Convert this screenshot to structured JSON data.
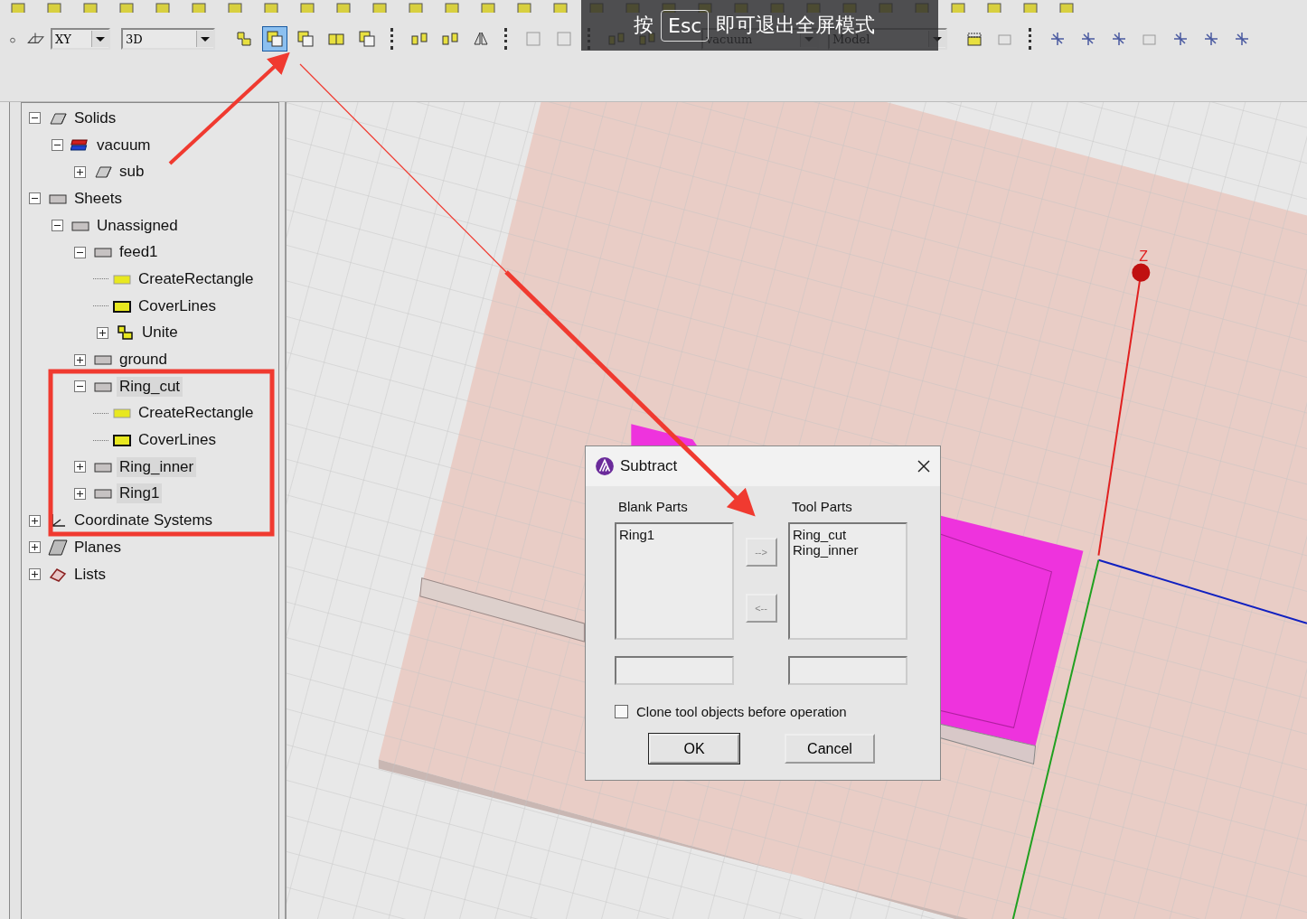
{
  "toolbar": {
    "combos": [
      {
        "value": "XY"
      },
      {
        "value": "3D"
      },
      {
        "value": "vacuum"
      },
      {
        "value": "Model"
      }
    ],
    "tools_left": [
      {
        "kind": "lshape",
        "selected": false
      },
      {
        "kind": "squares",
        "selected": true
      },
      {
        "kind": "squares",
        "selected": false
      },
      {
        "kind": "split",
        "selected": false
      },
      {
        "kind": "squares",
        "selected": false
      },
      {
        "kind": "sep"
      },
      {
        "kind": "align",
        "selected": false
      },
      {
        "kind": "align",
        "selected": false
      },
      {
        "kind": "mirror",
        "selected": false
      },
      {
        "kind": "sep"
      },
      {
        "kind": "frame",
        "selected": false
      },
      {
        "kind": "frame",
        "selected": false
      },
      {
        "kind": "sep"
      },
      {
        "kind": "align",
        "selected": false
      },
      {
        "kind": "align",
        "selected": false
      }
    ],
    "tools_right": [
      {
        "kind": "box",
        "selected": false
      },
      {
        "kind": "frame",
        "selected": false
      },
      {
        "kind": "sep"
      },
      {
        "kind": "axes",
        "selected": false
      },
      {
        "kind": "axes",
        "selected": false
      },
      {
        "kind": "axes",
        "selected": false
      },
      {
        "kind": "frame",
        "selected": false
      },
      {
        "kind": "axes",
        "selected": false
      },
      {
        "kind": "axes",
        "selected": false
      },
      {
        "kind": "axes",
        "selected": false
      }
    ]
  },
  "fullscreen_notice": {
    "before": "按",
    "key": "Esc",
    "after": "即可退出全屏模式"
  },
  "tree": [
    {
      "label": "Solids",
      "kind": "solid",
      "expanded": true,
      "selected": false,
      "children": [
        {
          "label": "vacuum",
          "kind": "material",
          "expanded": true,
          "selected": false,
          "children": [
            {
              "label": "sub",
              "kind": "solid",
              "expanded": false,
              "selected": false
            }
          ]
        }
      ]
    },
    {
      "label": "Sheets",
      "kind": "sheet",
      "expanded": true,
      "selected": false,
      "children": [
        {
          "label": "Unassigned",
          "kind": "sheet",
          "expanded": true,
          "selected": false,
          "children": [
            {
              "label": "feed1",
              "kind": "sheet",
              "expanded": true,
              "selected": false,
              "children": [
                {
                  "label": "CreateRectangle",
                  "kind": "rect-op",
                  "selected": false
                },
                {
                  "label": "CoverLines",
                  "kind": "cover-op",
                  "selected": false
                },
                {
                  "label": "Unite",
                  "kind": "unite-op",
                  "expanded": false,
                  "selected": false
                }
              ]
            },
            {
              "label": "ground",
              "kind": "sheet",
              "expanded": false,
              "selected": false
            },
            {
              "label": "Ring_cut",
              "kind": "sheet",
              "expanded": true,
              "selected": true,
              "children": [
                {
                  "label": "CreateRectangle",
                  "kind": "rect-op",
                  "selected": false
                },
                {
                  "label": "CoverLines",
                  "kind": "cover-op",
                  "selected": false
                }
              ]
            },
            {
              "label": "Ring_inner",
              "kind": "sheet",
              "expanded": false,
              "selected": true
            },
            {
              "label": "Ring1",
              "kind": "sheet",
              "expanded": false,
              "selected": true
            }
          ]
        }
      ]
    },
    {
      "label": "Coordinate Systems",
      "kind": "coord",
      "expanded": false,
      "selected": false
    },
    {
      "label": "Planes",
      "kind": "planes",
      "expanded": false,
      "selected": false
    },
    {
      "label": "Lists",
      "kind": "lists",
      "expanded": false,
      "selected": false
    }
  ],
  "viewport": {
    "axis_label": "Z"
  },
  "dialog": {
    "title": "Subtract",
    "blank_label": "Blank Parts",
    "tool_label": "Tool Parts",
    "blank_parts": [
      "Ring1"
    ],
    "tool_parts": [
      "Ring_cut",
      "Ring_inner"
    ],
    "add_button": "-->",
    "remove_button": "<--",
    "clone_option": {
      "label": "Clone tool objects before operation",
      "checked": false
    },
    "ok": "OK",
    "cancel": "Cancel"
  }
}
